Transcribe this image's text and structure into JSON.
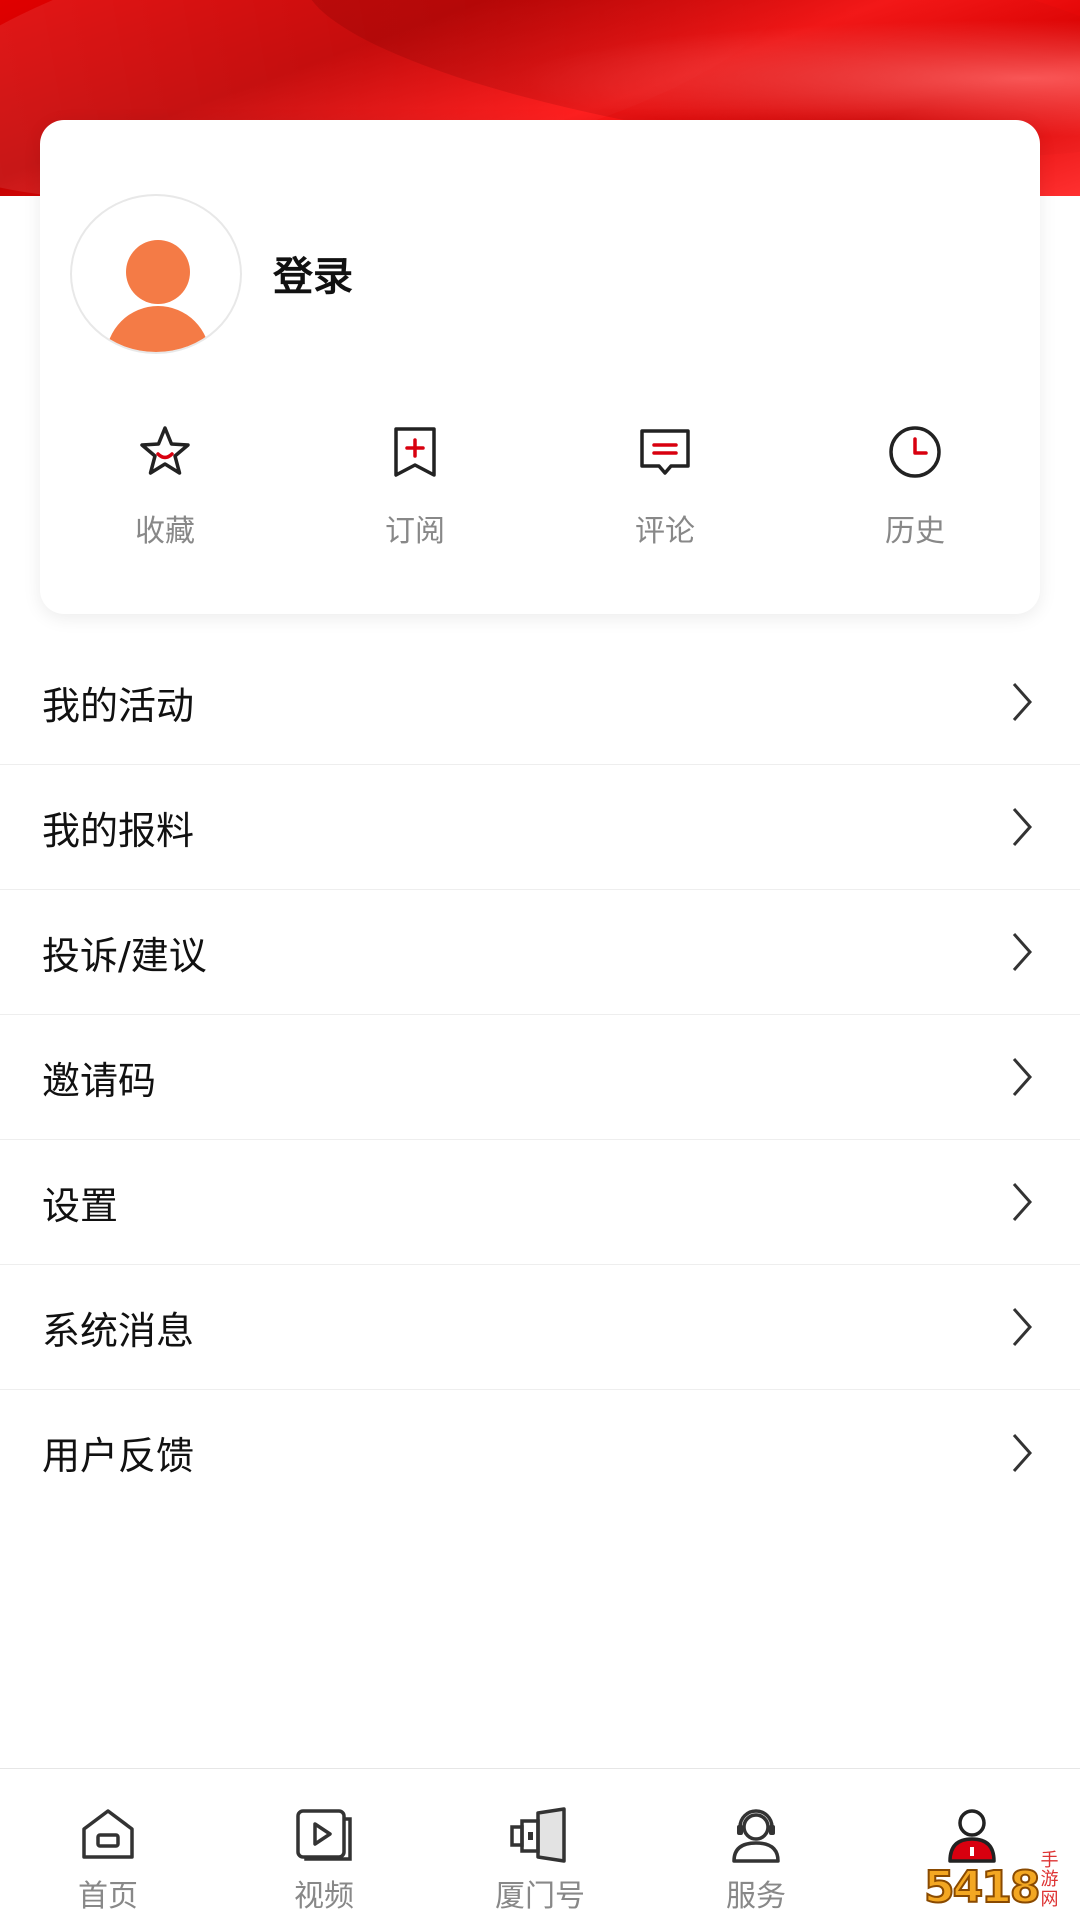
{
  "user": {
    "login_label": "登录"
  },
  "quick_actions": [
    {
      "id": "favorites",
      "label": "收藏",
      "icon": "star-icon"
    },
    {
      "id": "subscribe",
      "label": "订阅",
      "icon": "bookmark-plus-icon"
    },
    {
      "id": "comments",
      "label": "评论",
      "icon": "comment-icon"
    },
    {
      "id": "history",
      "label": "历史",
      "icon": "clock-icon"
    }
  ],
  "menu": [
    {
      "label": "我的活动"
    },
    {
      "label": "我的报料"
    },
    {
      "label": "投诉/建议"
    },
    {
      "label": "邀请码"
    },
    {
      "label": "设置"
    },
    {
      "label": "系统消息"
    },
    {
      "label": "用户反馈"
    }
  ],
  "tabbar": [
    {
      "label": "首页",
      "icon": "home-icon"
    },
    {
      "label": "视频",
      "icon": "video-icon"
    },
    {
      "label": "厦门号",
      "icon": "pages-icon"
    },
    {
      "label": "服务",
      "icon": "service-icon"
    },
    {
      "label": "",
      "icon": "profile-icon",
      "active": true
    }
  ],
  "watermark": {
    "number": "5418",
    "text": "手游网"
  },
  "colors": {
    "accent": "#d8000f",
    "avatar": "#f47b46",
    "label_gray": "#888888"
  }
}
